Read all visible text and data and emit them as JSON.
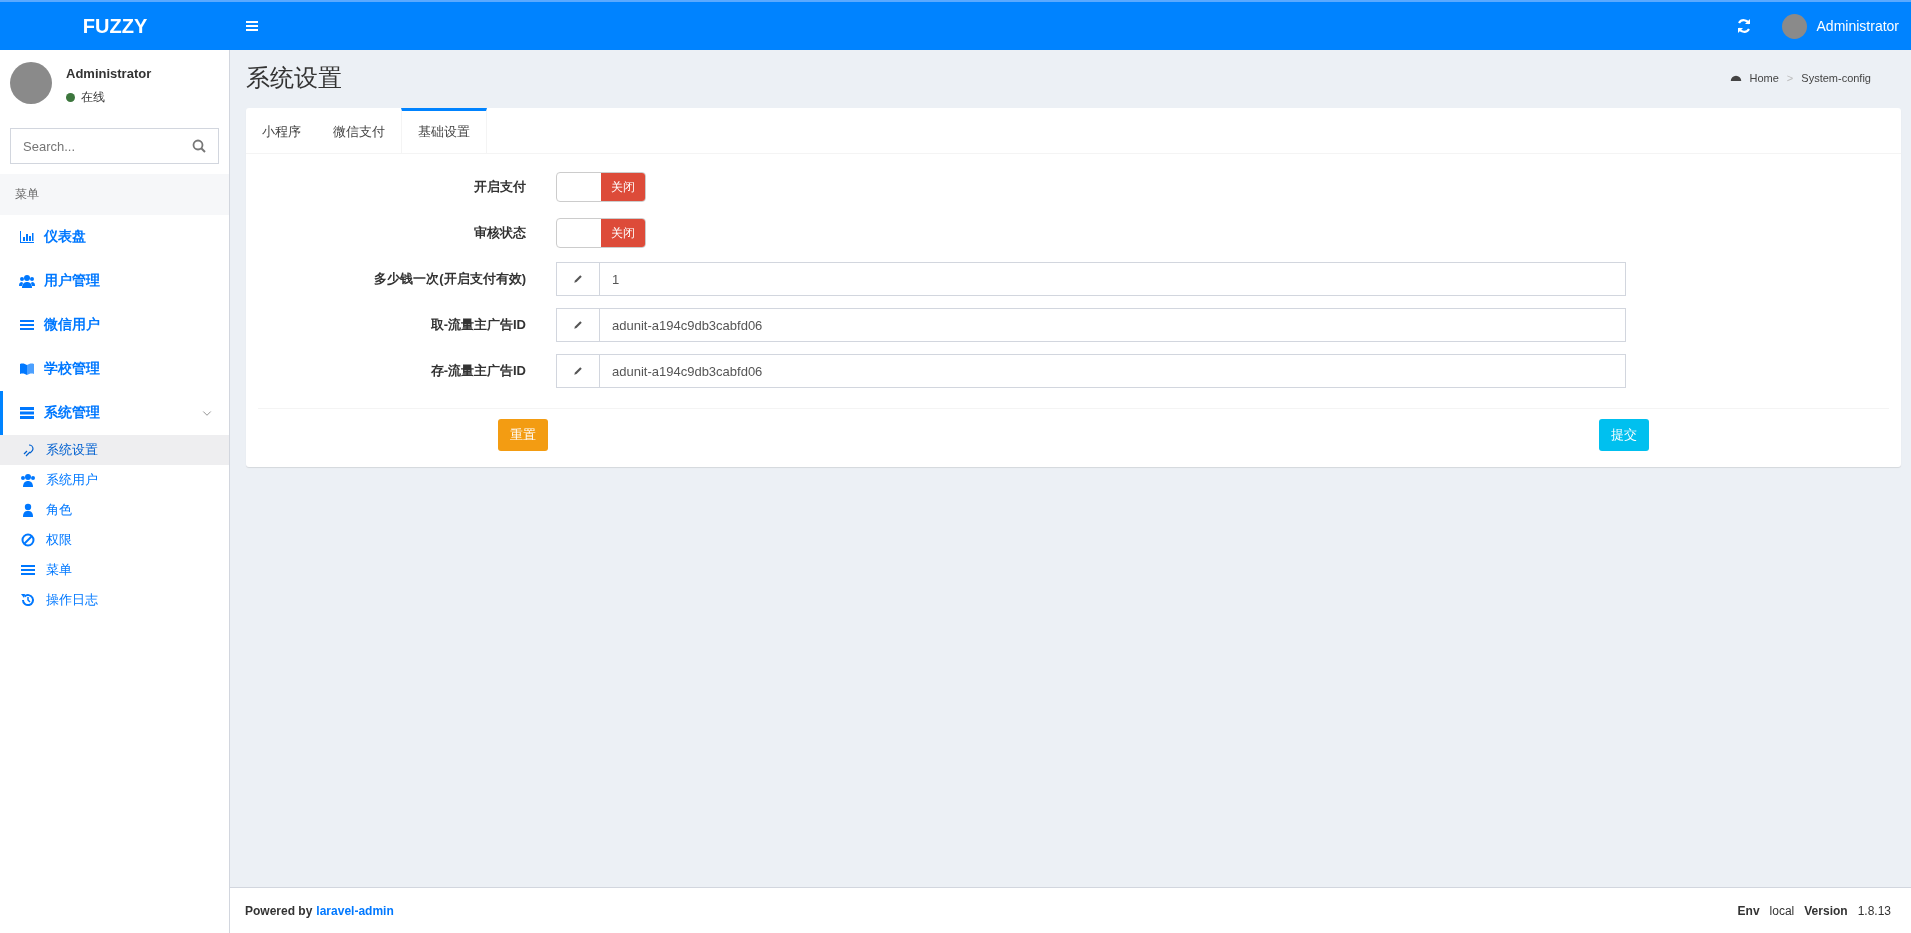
{
  "topbar": {
    "logo": "FUZZY",
    "user": "Administrator"
  },
  "sidebar": {
    "user": {
      "name": "Administrator",
      "status": "在线"
    },
    "search": {
      "placeholder": "Search..."
    },
    "header": "菜单",
    "items": [
      {
        "label": "仪表盘",
        "selected": false
      },
      {
        "label": "用户管理",
        "selected": false
      },
      {
        "label": "微信用户",
        "selected": false
      },
      {
        "label": "学校管理",
        "selected": false
      },
      {
        "label": "系统管理",
        "selected": true,
        "expanded": true,
        "children": [
          {
            "label": "系统设置",
            "selected": true
          },
          {
            "label": "系统用户",
            "selected": false
          },
          {
            "label": "角色",
            "selected": false
          },
          {
            "label": "权限",
            "selected": false
          },
          {
            "label": "菜单",
            "selected": false
          },
          {
            "label": "操作日志",
            "selected": false
          }
        ]
      }
    ]
  },
  "page": {
    "title": "系统设置",
    "breadcrumb": [
      "Home",
      "System-config"
    ],
    "breadcrumb_separator": ">",
    "tabs": [
      {
        "label": "小程序",
        "selected": false
      },
      {
        "label": "微信支付",
        "selected": false
      },
      {
        "label": "基础设置",
        "selected": true
      }
    ],
    "form": [
      {
        "kind": "switch",
        "label": "开启支付",
        "on": false,
        "state_text": "关闭"
      },
      {
        "kind": "switch",
        "label": "审核状态",
        "on": false,
        "state_text": "关闭"
      },
      {
        "kind": "text",
        "label": "多少钱一次(开启支付有效)",
        "value": "1"
      },
      {
        "kind": "text",
        "label": "取-流量主广告ID",
        "value": "adunit-a194c9db3cabfd06"
      },
      {
        "kind": "text",
        "label": "存-流量主广告ID",
        "value": "adunit-a194c9db3cabfd06"
      }
    ],
    "reset_button": "重置",
    "submit_button": "提交"
  },
  "footer": {
    "powered_by": "Powered by",
    "link": "laravel-admin",
    "env_label": "Env",
    "env": "local",
    "version_label": "Version",
    "version": "1.8.13"
  }
}
